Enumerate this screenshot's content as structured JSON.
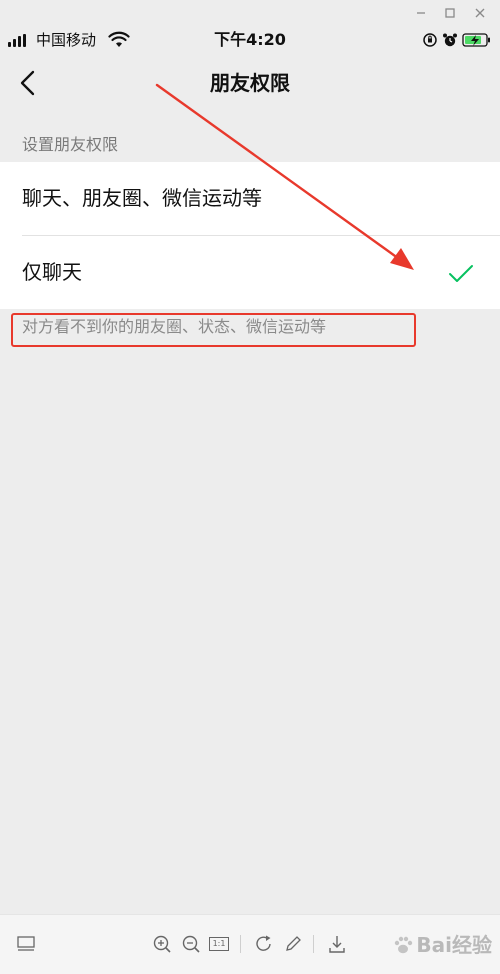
{
  "status_bar": {
    "carrier": "中国移动",
    "time": "下午4:20"
  },
  "nav": {
    "title": "朋友权限"
  },
  "section": {
    "header": "设置朋友权限"
  },
  "options": [
    {
      "label": "聊天、朋友圈、微信运动等",
      "selected": false
    },
    {
      "label": "仅聊天",
      "selected": true
    }
  ],
  "footer_note": "对方看不到你的朋友圈、状态、微信运动等",
  "toolbar": {
    "actual_size_label": "1:1"
  },
  "watermark": {
    "text": "Bai经验"
  },
  "colors": {
    "accent_green": "#07c160",
    "annotation_red": "#e8392c",
    "background": "#ededed"
  }
}
